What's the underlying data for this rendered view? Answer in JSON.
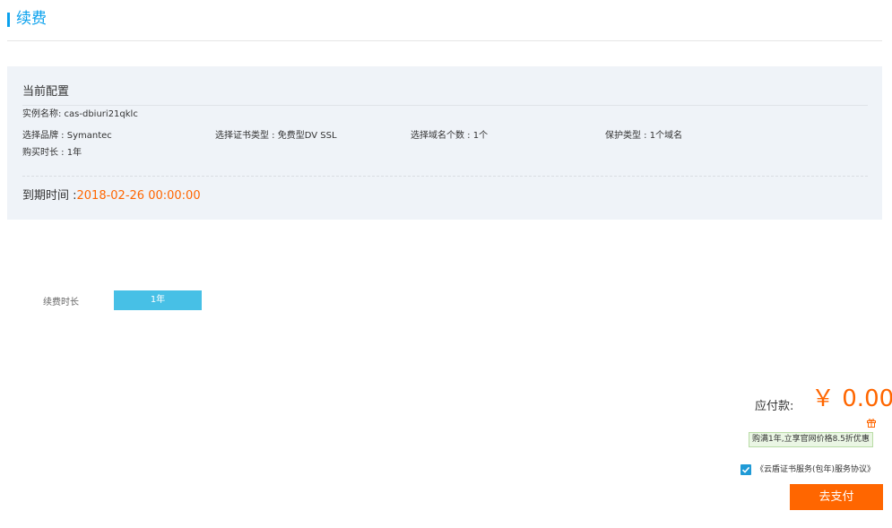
{
  "header": {
    "title": "续费"
  },
  "config": {
    "heading": "当前配置",
    "instance_name": "实例名称: cas-dbiuri21qklc",
    "brand": "选择品牌 : Symantec",
    "cert_type": "选择证书类型 : 免费型DV SSL",
    "domain_count": "选择域名个数 : 1个",
    "protection": "保护类型 : 1个域名",
    "purchase_duration": "购买时长 : 1年",
    "expire_label": "到期时间 :",
    "expire_value": "2018-02-26 00:00:00"
  },
  "renewal": {
    "duration_label": "续费时长",
    "duration_option": "1年"
  },
  "payment": {
    "label": "应付款:",
    "price": "￥ 0.00",
    "promo": "购满1年,立享官网价格8.5折优惠",
    "agreement": "《云盾证书服务(包年)服务协议》",
    "pay_button": "去支付"
  },
  "colors": {
    "accent": "#0aa1ed",
    "price": "#ff6600",
    "selected_option": "#47c0e6",
    "panel_bg": "#eff3f8"
  },
  "icons": {
    "gift": "gift-icon",
    "checkbox": "checkbox-checked-icon"
  }
}
